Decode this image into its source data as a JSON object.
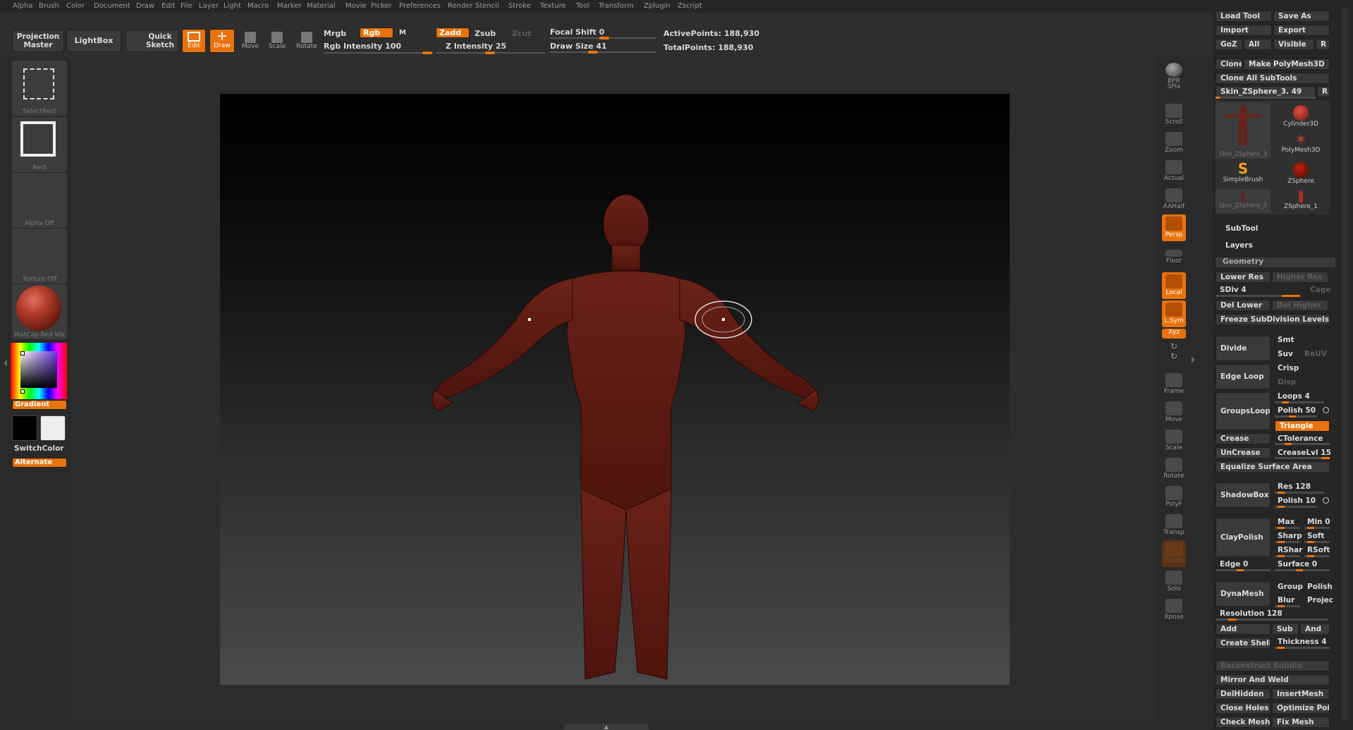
{
  "menu": [
    "Alpha",
    "Brush",
    "Color",
    "Document",
    "Draw",
    "Edit",
    "File",
    "Layer",
    "Light",
    "Macro",
    "Marker",
    "Material",
    "Movie",
    "Picker",
    "Preferences",
    "Render",
    "Stencil",
    "Stroke",
    "Texture",
    "Tool",
    "Transform",
    "Zplugin",
    "Zscript"
  ],
  "topbar": {
    "projection_master": "Projection Master",
    "lightbox": "LightBox",
    "quick_sketch": "Quick Sketch",
    "edit": "Edit",
    "draw": "Draw",
    "move": "Move",
    "scale": "Scale",
    "rotate": "Rotate",
    "mrgb": "Mrgb",
    "rgb": "Rgb",
    "m": "M",
    "rgb_intensity_label": "Rgb Intensity",
    "rgb_intensity": "100",
    "zadd": "Zadd",
    "zsub": "Zsub",
    "zcut": "Zcut",
    "z_intensity_label": "Z Intensity",
    "z_intensity": "25",
    "focal_shift_label": "Focal Shift",
    "focal_shift": "0",
    "draw_size_label": "Draw Size",
    "draw_size": "41",
    "active_points_label": "ActivePoints:",
    "active_points": "188,930",
    "total_points_label": "TotalPoints:",
    "total_points": "188,930"
  },
  "leftshelf": {
    "select_rect": "SelectRect",
    "rect": "Rect",
    "alpha": "Alpha Off",
    "texture": "Texture Off",
    "material": "MatCap Red Wa",
    "gradient": "Gradient",
    "switch_color": "SwitchColor",
    "alternate": "Alternate"
  },
  "rightshelf": [
    "BPR",
    "SPix",
    "Scroll",
    "Zoom",
    "Actual",
    "AAHalf",
    "Persp",
    "Floor",
    "Local",
    "L.Sym",
    "Xyz",
    "Frame",
    "Move",
    "Scale",
    "Rotate",
    "PolyF",
    "Transp",
    "Ghost",
    "Solo",
    "Xpose"
  ],
  "palette": {
    "load_tool": "Load Tool",
    "save_as": "Save As",
    "import": "Import",
    "export": "Export",
    "goz": "GoZ",
    "all": "All",
    "visible": "Visible",
    "r": "R",
    "clone": "Clone",
    "make_polymesh": "Make PolyMesh3D",
    "clone_all": "Clone All SubTools",
    "current_tool_label": "Skin_ZSphere_3.",
    "current_tool_value": "49",
    "tools": [
      {
        "name": "Skin_ZSphere_3",
        "icon": "figure"
      },
      {
        "name": "Cylinder3D",
        "icon": "cylinder"
      },
      {
        "name": "PolyMesh3D",
        "icon": "star"
      },
      {
        "name": "SimpleBrush",
        "icon": "s-brush"
      },
      {
        "name": "ZSphere",
        "icon": "sphere"
      },
      {
        "name": "Skin_ZSphere_3",
        "icon": "figure-small"
      },
      {
        "name": "ZSphere_1",
        "icon": "zsphere-figure"
      }
    ],
    "subtool": "SubTool",
    "layers": "Layers",
    "geometry": "Geometry",
    "lower_res": "Lower Res",
    "higher_res": "Higher Res",
    "sdiv_label": "SDiv",
    "sdiv": "4",
    "cage": "Cage",
    "del_lower": "Del Lower",
    "del_higher": "Del Higher",
    "freeze_subdiv": "Freeze SubDivision Levels",
    "divide": "Divide",
    "smt": "Smt",
    "suv": "Suv",
    "reuv": "ReUV",
    "edge_loop": "Edge Loop",
    "crisp": "Crisp",
    "disp": "Disp",
    "groups_loops": "GroupsLoops",
    "loops_label": "Loops",
    "loops": "4",
    "polish_label": "Polish",
    "polish": "50",
    "triangle": "Triangle",
    "crease": "Crease",
    "ctolerance": "CTolerance",
    "uncrease": "UnCrease",
    "creaselvl_label": "CreaseLvl",
    "creaselvl": "15",
    "equalize": "Equalize Surface Area",
    "shadowbox": "ShadowBox",
    "res_label": "Res",
    "res": "128",
    "polish2_label": "Polish",
    "polish2": "10",
    "max": "Max",
    "min_label": "Min",
    "min": "0",
    "claypolish": "ClayPolish",
    "sharp": "Sharp",
    "soft": "Soft",
    "rshar": "RShar",
    "rsoft": "RSoft",
    "edge_label": "Edge",
    "edge": "0",
    "surface_label": "Surface",
    "surface": "0",
    "dynamesh": "DynaMesh",
    "group": "Group",
    "polish3": "Polish",
    "blur": "Blur",
    "project": "Projec",
    "resolution_label": "Resolution",
    "resolution": "128",
    "add": "Add",
    "sub": "Sub",
    "and": "And",
    "create_shell": "Create Shell",
    "thickness_label": "Thickness",
    "thickness": "4",
    "reconstruct": "Reconstruct Subdiv",
    "mirror_weld": "Mirror And Weld",
    "delhidden": "DelHidden",
    "insertmesh": "InsertMesh",
    "close_holes": "Close Holes",
    "optimize": "Optimize Poi",
    "check_mesh": "Check Mesh",
    "fix_mesh": "Fix Mesh"
  },
  "colors": {
    "accent": "#e8730c",
    "model": "#5a1a12"
  }
}
